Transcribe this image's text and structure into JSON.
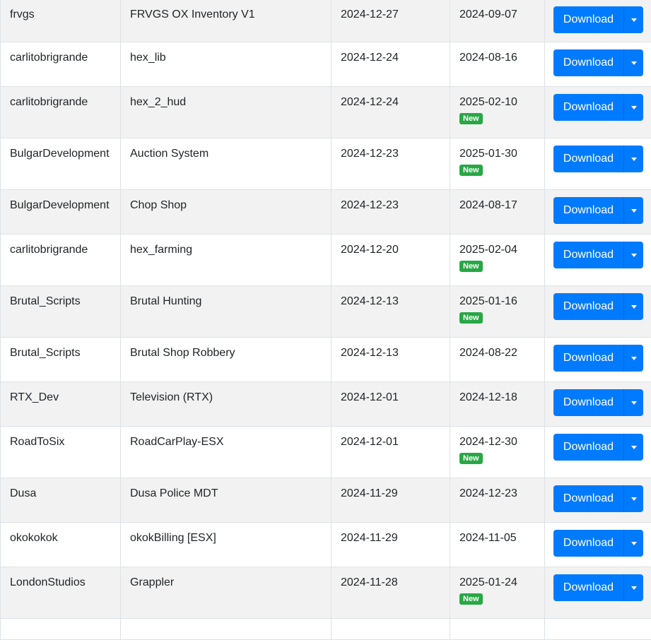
{
  "table": {
    "new_badge_label": "New",
    "download_label": "Download",
    "colors": {
      "button": "#007bff",
      "badge": "#28a745",
      "stripe": "#f2f2f2"
    },
    "rows": [
      {
        "author": "frvgs",
        "name": "FRVGS OX Inventory V1",
        "added": "2024-12-27",
        "updated": "2024-09-07",
        "is_new": false
      },
      {
        "author": "carlitobrigrande",
        "name": "hex_lib",
        "added": "2024-12-24",
        "updated": "2024-08-16",
        "is_new": false
      },
      {
        "author": "carlitobrigrande",
        "name": "hex_2_hud",
        "added": "2024-12-24",
        "updated": "2025-02-10",
        "is_new": true
      },
      {
        "author": "BulgarDevelopment",
        "name": "Auction System",
        "added": "2024-12-23",
        "updated": "2025-01-30",
        "is_new": true
      },
      {
        "author": "BulgarDevelopment",
        "name": "Chop Shop",
        "added": "2024-12-23",
        "updated": "2024-08-17",
        "is_new": false
      },
      {
        "author": "carlitobrigrande",
        "name": "hex_farming",
        "added": "2024-12-20",
        "updated": "2025-02-04",
        "is_new": true
      },
      {
        "author": "Brutal_Scripts",
        "name": "Brutal Hunting",
        "added": "2024-12-13",
        "updated": "2025-01-16",
        "is_new": true
      },
      {
        "author": "Brutal_Scripts",
        "name": "Brutal Shop Robbery",
        "added": "2024-12-13",
        "updated": "2024-08-22",
        "is_new": false
      },
      {
        "author": "RTX_Dev",
        "name": "Television (RTX)",
        "added": "2024-12-01",
        "updated": "2024-12-18",
        "is_new": false
      },
      {
        "author": "RoadToSix",
        "name": "RoadCarPlay-ESX",
        "added": "2024-12-01",
        "updated": "2024-12-30",
        "is_new": true
      },
      {
        "author": "Dusa",
        "name": "Dusa Police MDT",
        "added": "2024-11-29",
        "updated": "2024-12-23",
        "is_new": false
      },
      {
        "author": "okokokok",
        "name": "okokBilling [ESX]",
        "added": "2024-11-29",
        "updated": "2024-11-05",
        "is_new": false
      },
      {
        "author": "LondonStudios",
        "name": "Grappler",
        "added": "2024-11-28",
        "updated": "2025-01-24",
        "is_new": true
      },
      {
        "author": "",
        "name": "",
        "added": "",
        "updated": "",
        "is_new": false
      }
    ]
  }
}
